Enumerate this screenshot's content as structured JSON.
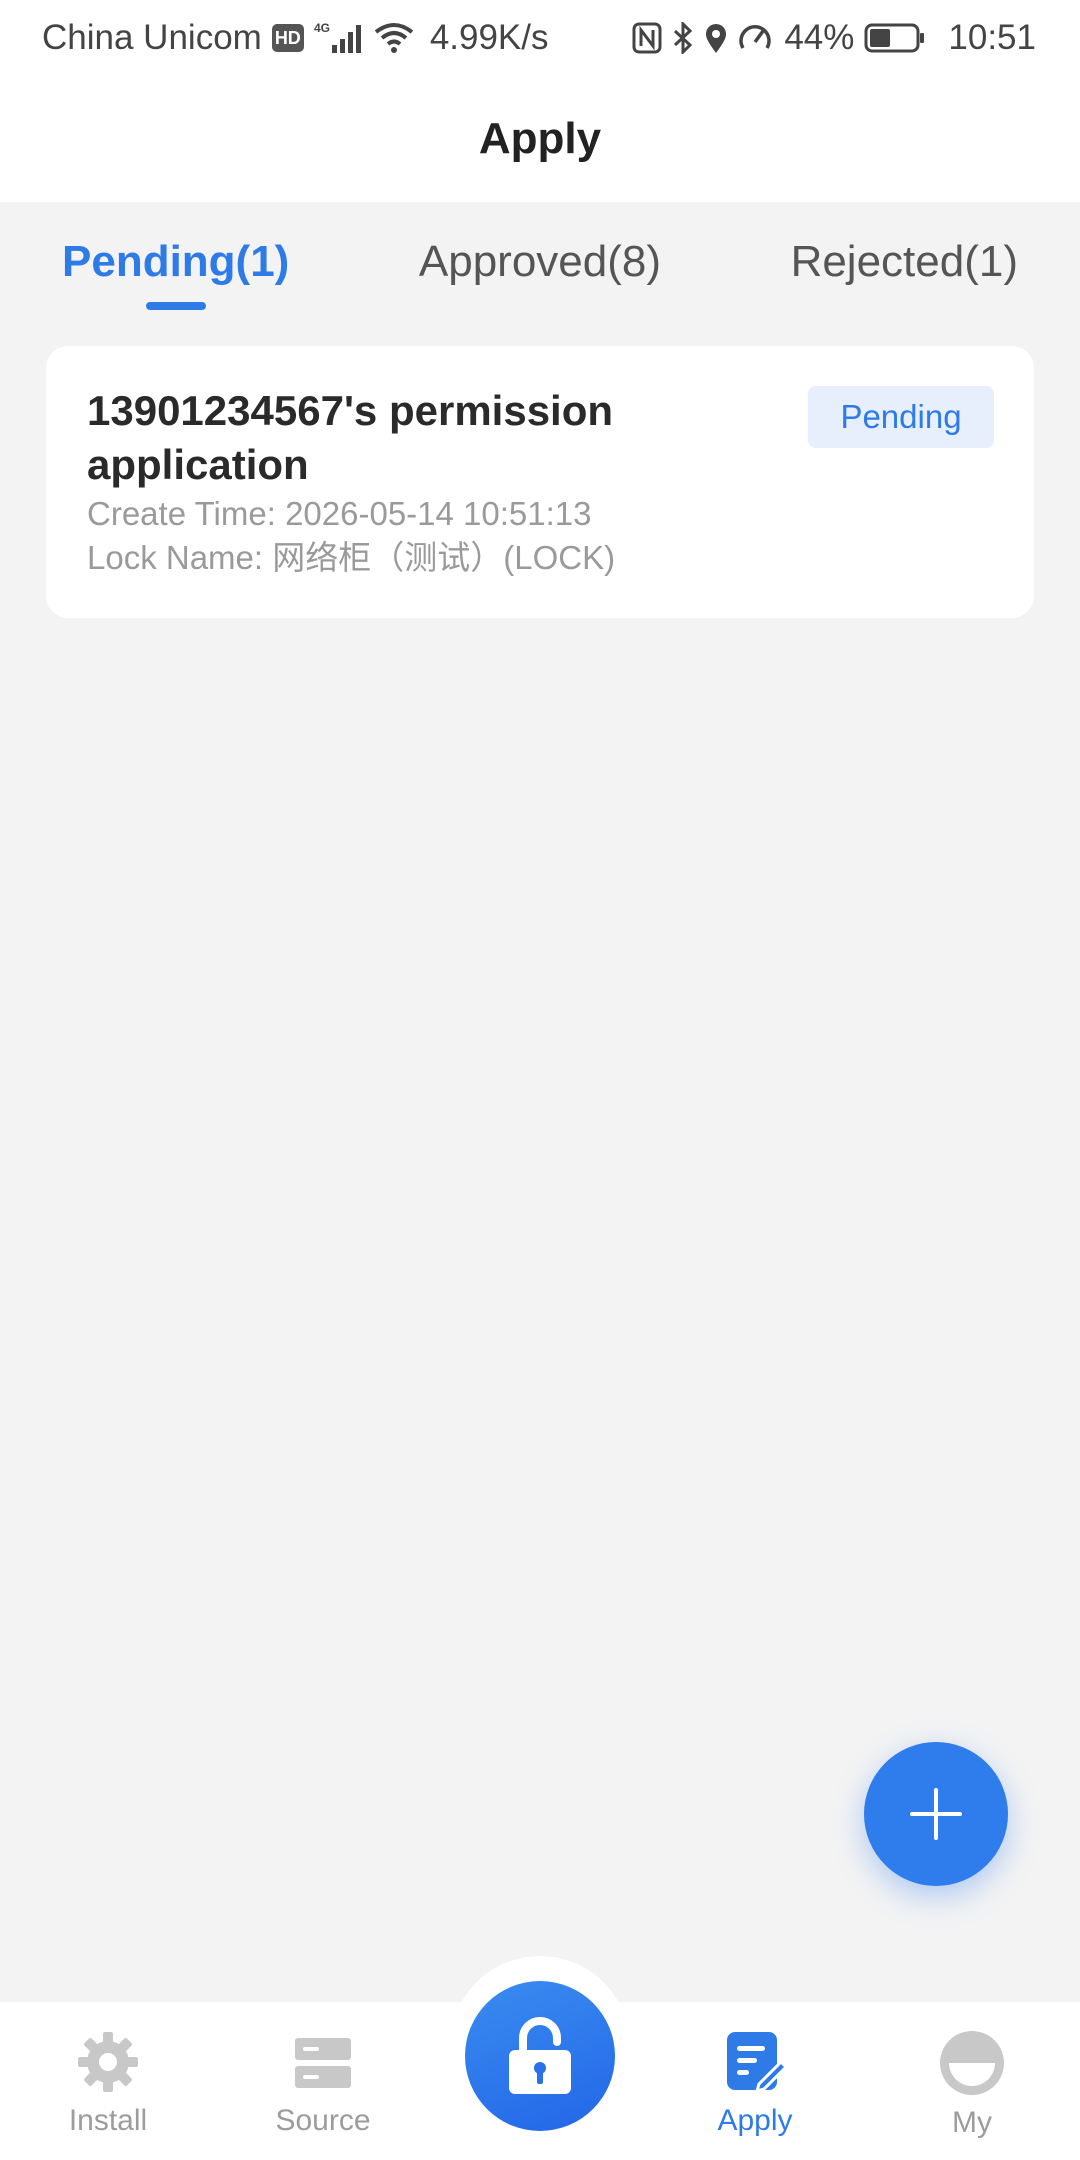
{
  "status_bar": {
    "carrier": "China Unicom",
    "hd_badge": "HD",
    "network_type": "4G",
    "speed": "4.99K/s",
    "battery": "44%",
    "time": "10:51",
    "icons": [
      "hd-badge",
      "signal-icon",
      "wifi-icon",
      "nfc-icon",
      "bluetooth-icon",
      "location-icon",
      "speedometer-icon",
      "battery-icon"
    ]
  },
  "header": {
    "title": "Apply"
  },
  "tabs": [
    {
      "label": "Pending(1)",
      "active": true
    },
    {
      "label": "Approved(8)",
      "active": false
    },
    {
      "label": "Rejected(1)",
      "active": false
    }
  ],
  "applications": [
    {
      "title": "13901234567's permission application",
      "create_time": "Create Time: 2026-05-14 10:51:13",
      "lock_name": "Lock Name: 网络柜（测试）(LOCK)",
      "status": "Pending"
    }
  ],
  "fab": {
    "icon": "plus-icon"
  },
  "bottom_nav": {
    "items": [
      {
        "label": "Install",
        "icon": "gear-icon",
        "active": false
      },
      {
        "label": "Source",
        "icon": "server-icon",
        "active": false
      },
      {
        "label": "",
        "icon": "unlock-icon",
        "active": false
      },
      {
        "label": "Apply",
        "icon": "edit-document-icon",
        "active": true
      },
      {
        "label": "My",
        "icon": "avatar-icon",
        "active": false
      }
    ]
  },
  "colors": {
    "accent": "#2e7be8",
    "background": "#f3f3f4",
    "badge_bg": "#e7effc",
    "muted_text": "#9a9a9a"
  }
}
